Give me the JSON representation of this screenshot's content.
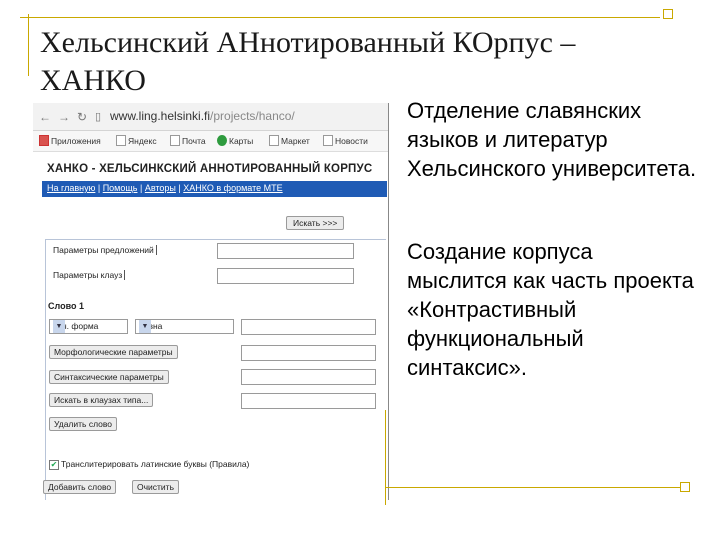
{
  "slide": {
    "title": "Хельсинский АНнотированный КОрпус – ХАНКО",
    "paragraph1": "Отделение славянских языков и литератур Хельсинского университета.",
    "paragraph2": "Создание корпуса мыслится как часть проекта «Контрастивный функциональный синтаксис»."
  },
  "browser": {
    "url_host": "www.ling.helsinki.fi",
    "url_path": "/projects/hanco/",
    "bookmarks": [
      "Приложения",
      "Яндекс",
      "Почта",
      "Карты",
      "Маркет",
      "Новости"
    ]
  },
  "page": {
    "corpus_title": "ХАНКО - ХЕЛЬСИНКСКИЙ АННОТИРОВАННЫЙ КОРПУС",
    "nav": [
      "На главную",
      "Помощь",
      "Авторы",
      "ХАНКО в формате МТЕ"
    ],
    "search_button": "Искать >>>",
    "sentence_params": "Параметры предложений",
    "clause_params": "Параметры клауз",
    "word_heading": "Слово 1",
    "select_form": "нач. форма",
    "select_equal": "равна",
    "morph_params": "Морфологические параметры",
    "synt_params": "Синтаксические параметры",
    "search_clause_type": "Искать в клаузах типа...",
    "delete_word": "Удалить слово",
    "transliterate": "Транслитерировать латинские буквы (Правила)",
    "add_word": "Добавить слово",
    "clear": "Очистить"
  },
  "colors": {
    "accent_gold": "#c9a800",
    "nav_blue": "#1f5bb5"
  }
}
